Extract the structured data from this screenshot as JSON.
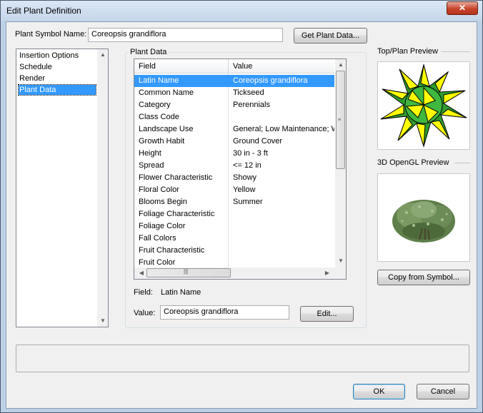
{
  "window": {
    "title": "Edit Plant Definition",
    "close_glyph": "✕"
  },
  "symbol": {
    "label": "Plant Symbol Name:",
    "value": "Coreopsis grandiflora",
    "get_button": "Get Plant Data..."
  },
  "nav": {
    "items": [
      {
        "label": "Insertion Options",
        "selected": false
      },
      {
        "label": "Schedule",
        "selected": false
      },
      {
        "label": "Render",
        "selected": false
      },
      {
        "label": "Plant Data",
        "selected": true
      }
    ]
  },
  "plant_data": {
    "group_title": "Plant Data",
    "columns": {
      "field": "Field",
      "value": "Value"
    },
    "rows": [
      {
        "field": "Latin Name",
        "value": "Coreopsis grandiflora",
        "selected": true
      },
      {
        "field": "Common Name",
        "value": "Tickseed"
      },
      {
        "field": "Category",
        "value": "Perennials"
      },
      {
        "field": "Class Code",
        "value": ""
      },
      {
        "field": "Landscape Use",
        "value": "General; Low Maintenance; W"
      },
      {
        "field": "Growth Habit",
        "value": "Ground Cover"
      },
      {
        "field": "Height",
        "value": "30 in - 3 ft"
      },
      {
        "field": "Spread",
        "value": "<= 12 in"
      },
      {
        "field": "Flower Characteristic",
        "value": "Showy"
      },
      {
        "field": "Floral Color",
        "value": "Yellow"
      },
      {
        "field": "Blooms Begin",
        "value": "Summer"
      },
      {
        "field": "Foliage Characteristic",
        "value": ""
      },
      {
        "field": "Foliage Color",
        "value": ""
      },
      {
        "field": "Fall Colors",
        "value": ""
      },
      {
        "field": "Fruit Characteristic",
        "value": ""
      },
      {
        "field": "Fruit Color",
        "value": ""
      }
    ],
    "field_label": "Field:",
    "field_value": "Latin Name",
    "value_label": "Value:",
    "value_value": "Coreopsis grandiflora",
    "edit_button": "Edit..."
  },
  "previews": {
    "top_plan_title": "Top/Plan Preview",
    "opengl_title": "3D OpenGL Preview",
    "copy_button": "Copy from Symbol..."
  },
  "footer": {
    "ok": "OK",
    "cancel": "Cancel"
  },
  "colors": {
    "selection": "#3399ff",
    "symbol_yellow": "#ffff00",
    "symbol_green": "#2e9d2e"
  }
}
